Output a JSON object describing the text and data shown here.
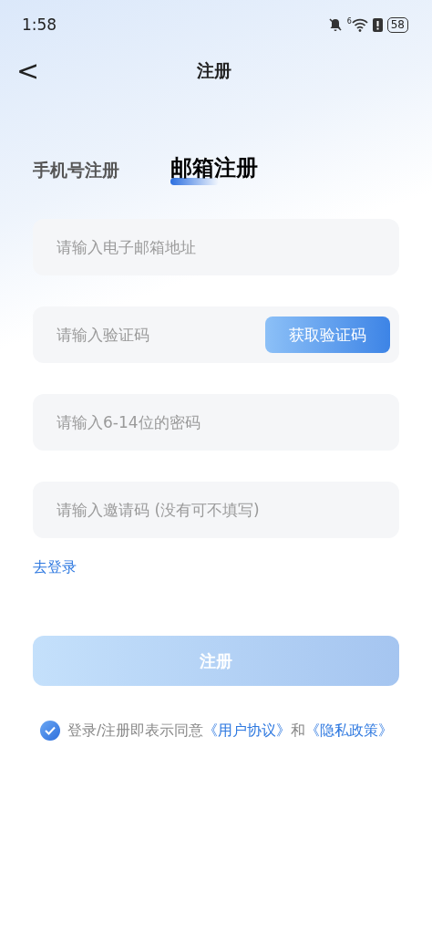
{
  "status_bar": {
    "time": "1:58",
    "wifi_badge": "6",
    "battery": "58"
  },
  "header": {
    "back": "<",
    "title": "注册"
  },
  "tabs": [
    {
      "label": "手机号注册",
      "selected": false
    },
    {
      "label": "邮箱注册",
      "selected": true
    }
  ],
  "fields": [
    {
      "kind": "text",
      "placeholder": "请输入电子邮箱地址"
    },
    {
      "kind": "code",
      "placeholder": "请输入验证码",
      "button": "获取验证码"
    },
    {
      "kind": "text",
      "placeholder": "请输入6-14位的密码"
    },
    {
      "kind": "text",
      "placeholder": "请输入邀请码 (没有可不填写)"
    }
  ],
  "login_link": "去登录",
  "submit": {
    "label": "注册",
    "disabled": true
  },
  "agreement": {
    "checked": true,
    "parts": [
      {
        "kind": "text",
        "text": "登录/注册即表示同意"
      },
      {
        "kind": "link",
        "text": "《用户协议》"
      },
      {
        "kind": "text",
        "text": "和"
      },
      {
        "kind": "link",
        "text": "《隐私政策》"
      }
    ]
  }
}
